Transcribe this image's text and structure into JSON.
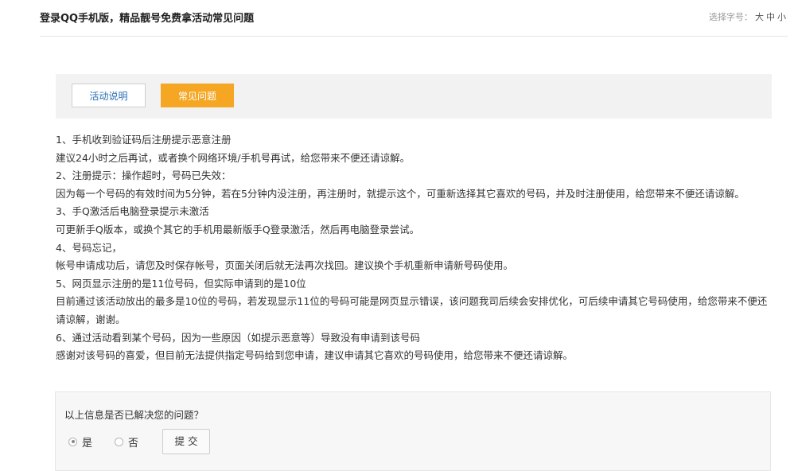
{
  "header": {
    "title": "登录QQ手机版，精品靓号免费拿活动常见问题",
    "font_size_label": "选择字号：",
    "font_size_options": [
      "大",
      "中",
      "小"
    ]
  },
  "tabs": [
    {
      "label": "活动说明",
      "active": false
    },
    {
      "label": "常见问题",
      "active": true
    }
  ],
  "faq": [
    {
      "question": "1、手机收到验证码后注册提示恶意注册",
      "answer": "建议24小时之后再试，或者换个网络环境/手机号再试，给您带来不便还请谅解。"
    },
    {
      "question": "2、注册提示：操作超时，号码已失效：",
      "answer": "因为每一个号码的有效时间为5分钟，若在5分钟内没注册，再注册时，就提示这个，可重新选择其它喜欢的号码，并及时注册使用，给您带来不便还请谅解。"
    },
    {
      "question": "3、手Q激活后电脑登录提示未激活",
      "answer": "可更新手Q版本，或换个其它的手机用最新版手Q登录激活，然后再电脑登录尝试。"
    },
    {
      "question": "4、号码忘记，",
      "answer": "帐号申请成功后，请您及时保存帐号，页面关闭后就无法再次找回。建议换个手机重新申请新号码使用。"
    },
    {
      "question": "5、网页显示注册的是11位号码，但实际申请到的是10位",
      "answer": "目前通过该活动放出的最多是10位的号码，若发现显示11位的号码可能是网页显示错误，该问题我司后续会安排优化，可后续申请其它号码使用，给您带来不便还请谅解，谢谢。"
    },
    {
      "question": "6、通过活动看到某个号码，因为一些原因（如提示恶意等）导致没有申请到该号码",
      "answer": "感谢对该号码的喜爱，但目前无法提供指定号码给到您申请，建议申请其它喜欢的号码使用，给您带来不便还请谅解。"
    }
  ],
  "feedback": {
    "question": "以上信息是否已解决您的问题？",
    "option_yes": "是",
    "option_no": "否",
    "selected": "是",
    "submit_label": "提交"
  }
}
